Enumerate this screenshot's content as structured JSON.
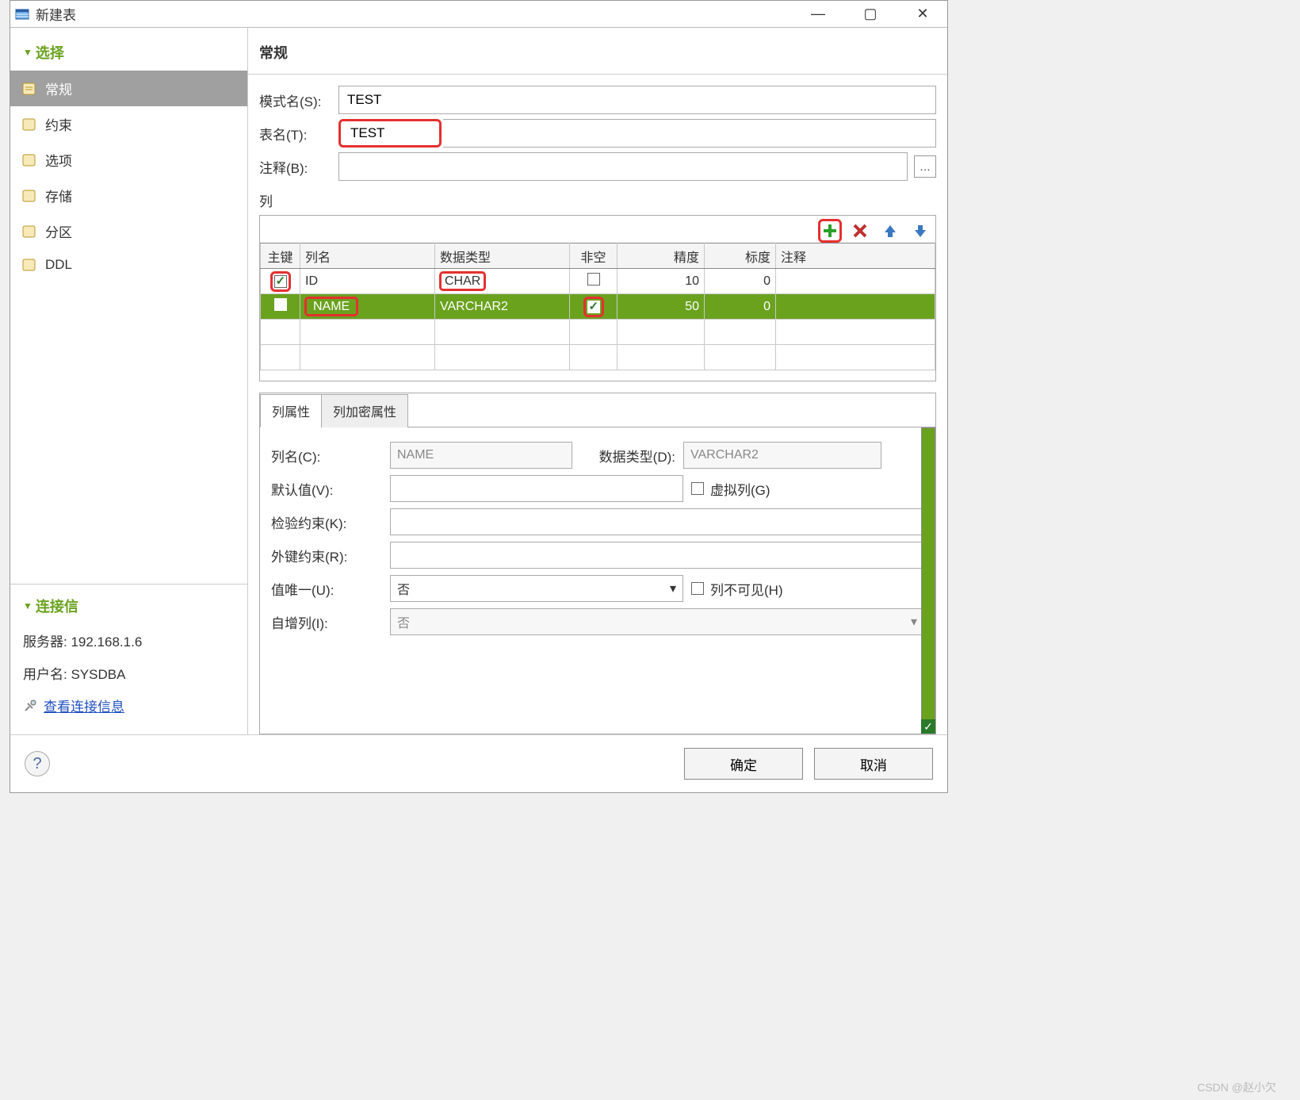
{
  "window": {
    "title": "新建表"
  },
  "sidebar": {
    "select_header": "选择",
    "items": [
      {
        "label": "常规"
      },
      {
        "label": "约束"
      },
      {
        "label": "选项"
      },
      {
        "label": "存储"
      },
      {
        "label": "分区"
      },
      {
        "label": "DDL"
      }
    ],
    "conn_header": "连接信",
    "server_label": "服务器:",
    "server_value": "192.168.1.6",
    "user_label": "用户名:",
    "user_value": "SYSDBA",
    "view_link": "查看连接信息"
  },
  "main": {
    "title": "常规",
    "schema_label": "模式名(S):",
    "schema_value": "TEST",
    "table_label": "表名(T):",
    "table_value": "TEST",
    "comment_label": "注释(B):",
    "comment_value": "",
    "columns_label": "列"
  },
  "grid": {
    "headers": {
      "pk": "主键",
      "name": "列名",
      "type": "数据类型",
      "notnull": "非空",
      "precision": "精度",
      "scale": "标度",
      "comment": "注释"
    },
    "rows": [
      {
        "pk": true,
        "name": "ID",
        "type": "CHAR",
        "notnull": false,
        "precision": "10",
        "scale": "0",
        "comment": ""
      },
      {
        "pk": false,
        "name": "NAME",
        "type": "VARCHAR2",
        "notnull": true,
        "precision": "50",
        "scale": "0",
        "comment": ""
      }
    ]
  },
  "tabs": {
    "attr": "列属性",
    "encrypt": "列加密属性"
  },
  "attrs": {
    "col_name_label": "列名(C):",
    "col_name_value": "NAME",
    "data_type_label": "数据类型(D):",
    "data_type_value": "VARCHAR2",
    "default_label": "默认值(V):",
    "default_value": "",
    "virtual_label": "虚拟列(G)",
    "check_label": "检验约束(K):",
    "check_value": "",
    "fk_label": "外键约束(R):",
    "fk_value": "",
    "unique_label": "值唯一(U):",
    "unique_value": "否",
    "invisible_label": "列不可见(H)",
    "autoinc_label": "自增列(I):",
    "autoinc_value": "否"
  },
  "footer": {
    "ok": "确定",
    "cancel": "取消"
  },
  "watermark": "CSDN @赵小欠"
}
